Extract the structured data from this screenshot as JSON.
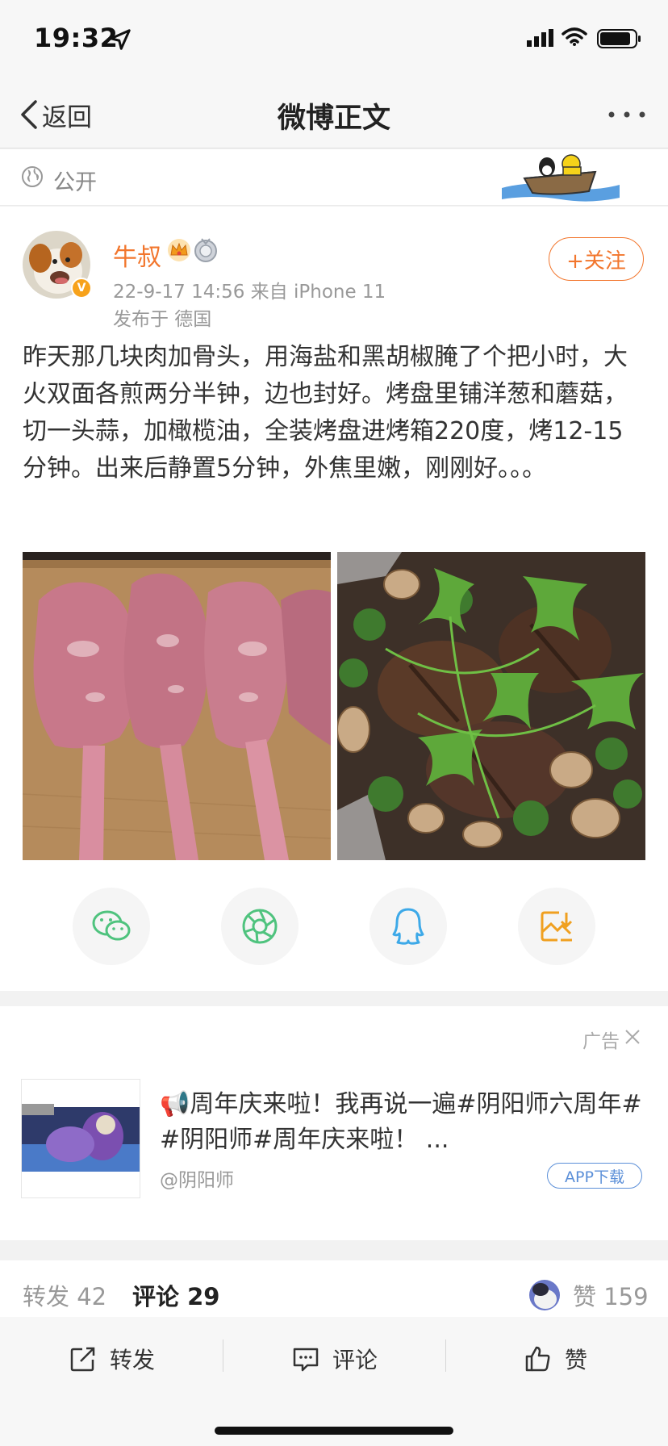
{
  "status_bar": {
    "time": "19:32"
  },
  "nav": {
    "back_label": "返回",
    "title": "微博正文"
  },
  "visibility": {
    "label": "公开"
  },
  "post": {
    "username": "牛叔",
    "meta": "22-9-17 14:56   来自 iPhone 11",
    "location": "发布于 德国",
    "follow_label": "+关注",
    "text": "昨天那几块肉加骨头，用海盐和黑胡椒腌了个把小时，大火双面各煎两分半钟，边也封好。烤盘里铺洋葱和蘑菇，切一头蒜，加橄榄油，全装烤盘进烤箱220度，烤12-15分钟。出来后静置5分钟，外焦里嫩，刚刚好。。。",
    "share_icons": [
      "wechat-icon",
      "moments-icon",
      "qq-icon",
      "save-image-icon"
    ]
  },
  "ad": {
    "label": "广告",
    "text": "📢周年庆来啦！我再说一遍#阴阳师六周年# #阴阳师#周年庆来啦！ ...",
    "source": "@阴阳师",
    "download_label": "APP下载"
  },
  "stats": {
    "repost": "转发 42",
    "comment": "评论 29",
    "like": "赞 159"
  },
  "actions": {
    "repost": "转发",
    "comment": "评论",
    "like": "赞"
  },
  "colors": {
    "accent": "#f2762d",
    "link": "#5b8fd8",
    "wechat": "#4fc37e",
    "qq": "#3da9e8",
    "save": "#f0a020"
  }
}
